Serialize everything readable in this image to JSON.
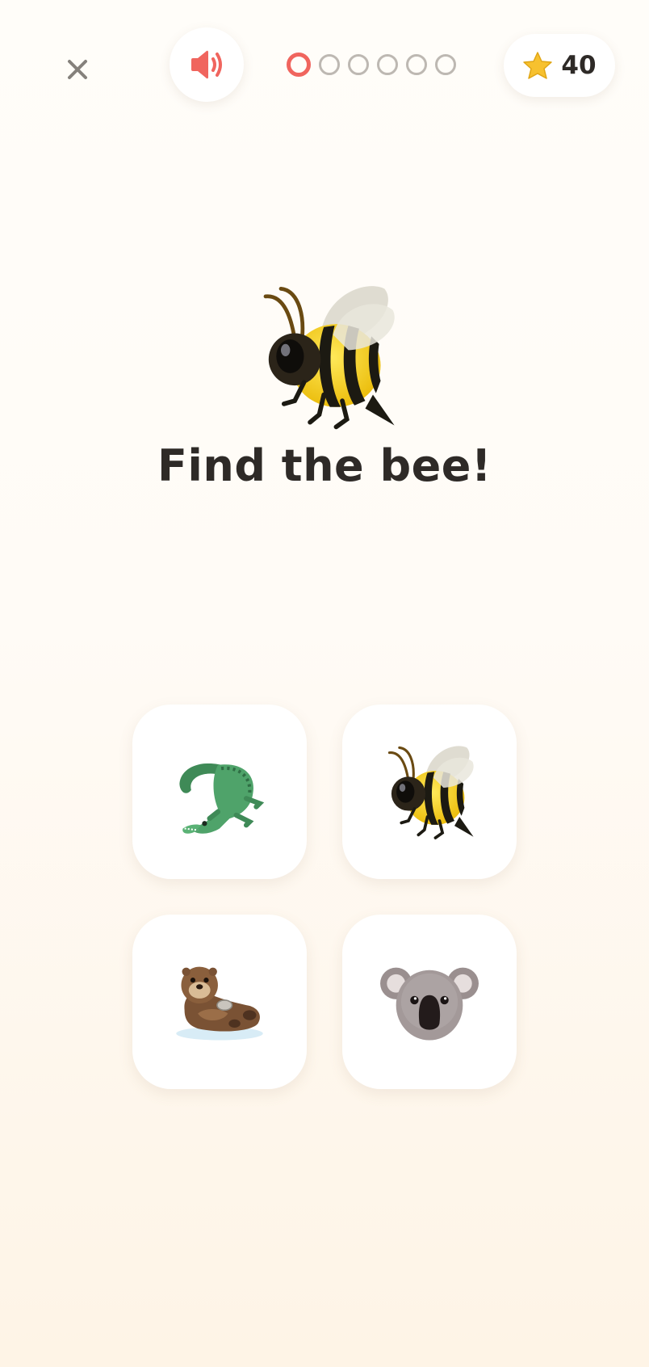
{
  "header": {
    "close_icon": "close-icon",
    "sound_icon": "speaker-icon",
    "progress": {
      "current": 1,
      "total": 6
    },
    "score": {
      "icon": "star-icon",
      "value": "40"
    }
  },
  "prompt": {
    "icon": "bee-icon",
    "text": "Find the bee!"
  },
  "options": [
    {
      "icon": "crocodile-icon"
    },
    {
      "icon": "bee-icon"
    },
    {
      "icon": "otter-icon"
    },
    {
      "icon": "koala-icon"
    }
  ],
  "colors": {
    "accent": "#f0655e",
    "inactive_dot": "#bdb8b2",
    "text": "#2e2a27",
    "card_bg": "#ffffff",
    "star": "#f7c12f"
  }
}
